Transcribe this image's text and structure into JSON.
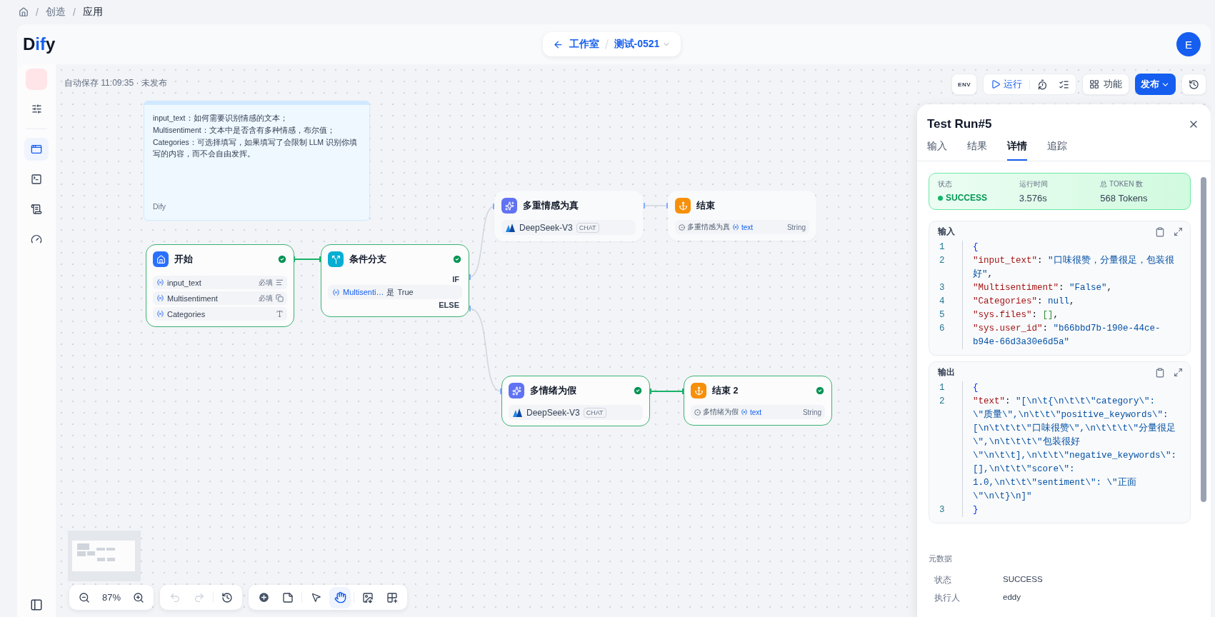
{
  "breadcrumb": {
    "items": [
      {
        "separator": "/",
        "label": "创造"
      },
      {
        "separator": "/",
        "label": "应用"
      }
    ]
  },
  "header": {
    "logo": [
      {
        "text": "D",
        "accent": false
      },
      {
        "text": "if",
        "accent": true
      },
      {
        "text": "y",
        "accent": false
      }
    ],
    "back": "工作室",
    "app": "测试-0521",
    "avatar": "E"
  },
  "sidebar": {
    "items": [
      {
        "kind": "orchestrate",
        "selected": true
      },
      {
        "kind": "api",
        "selected": false
      },
      {
        "kind": "logs",
        "selected": false
      },
      {
        "kind": "monitor",
        "selected": false
      }
    ]
  },
  "canvas": {
    "autosave": "自动保存 11:09:35 · 未发布",
    "toolbar": {
      "env": "ENV",
      "run": "运行",
      "features": "功能",
      "publish": "发布"
    },
    "note": {
      "lines": [
        "input_text：如何需要识别情感的文本；",
        "Multisentiment：文本中是否含有多种情感，布尔值；",
        "Categories：可选择填写，如果填写了会限制 LLM 识别你填写的内容，而不会自由发挥。"
      ],
      "author": "Dify"
    },
    "nodes": [
      {
        "kind": "start",
        "title": "开始",
        "ran": true,
        "variables": [
          {
            "name": "input_text",
            "required": "必填",
            "kind": "text"
          },
          {
            "name": "Multisentiment",
            "required": "必填",
            "kind": "select"
          },
          {
            "name": "Categories",
            "kind": "paragraph"
          }
        ]
      },
      {
        "kind": "if-else",
        "title": "条件分支",
        "ran": true,
        "if_label": "IF",
        "condition": {
          "variable": "Multisenti…",
          "operator": "是",
          "value": "True"
        },
        "else_label": "ELSE"
      },
      {
        "kind": "llm",
        "title": "多重情感为真",
        "ran": false,
        "model": "DeepSeek-V3",
        "mode": "CHAT"
      },
      {
        "kind": "end",
        "title": "结束",
        "ran": false,
        "output": {
          "source": "多重情感为真",
          "variable": "text",
          "type": "String"
        }
      },
      {
        "kind": "llm",
        "title": "多情绪为假",
        "ran": true,
        "model": "DeepSeek-V3",
        "mode": "CHAT"
      },
      {
        "kind": "end",
        "title": "结束 2",
        "ran": true,
        "output": {
          "source": "多情绪为假",
          "variable": "text",
          "type": "String"
        }
      }
    ],
    "edges": [
      {
        "ran": true
      },
      {
        "ran": false
      },
      {
        "ran": false
      },
      {
        "ran": false
      },
      {
        "ran": true
      }
    ],
    "zoom": "87%",
    "modes": [
      {
        "kind": "pointer",
        "selected": false
      },
      {
        "kind": "hand",
        "selected": true
      }
    ]
  },
  "run_panel": {
    "title": "Test Run#5",
    "tabs": [
      {
        "label": "输入",
        "selected": false
      },
      {
        "label": "结果",
        "selected": false
      },
      {
        "label": "详情",
        "selected": true
      },
      {
        "label": "追踪",
        "selected": false
      }
    ],
    "summary": [
      {
        "kind": "status",
        "label": "状态",
        "value": "SUCCESS"
      },
      {
        "kind": "plain",
        "label": "运行时间",
        "value": "3.576s"
      },
      {
        "kind": "plain",
        "label": "总 TOKEN 数",
        "value": "568 Tokens"
      }
    ],
    "blocks": [
      {
        "title": "输入",
        "lines": [
          {
            "num": "1",
            "parts": [
              {
                "kind": "bracket",
                "text": "{"
              }
            ]
          },
          {
            "num": "2",
            "parts": [
              {
                "kind": "key",
                "text": "\"input_text\""
              },
              {
                "kind": "punct",
                "text": ": "
              },
              {
                "kind": "string",
                "text": "\"口味很赞，分量很足，包装很好\""
              },
              {
                "kind": "punct",
                "text": ","
              }
            ]
          },
          {
            "num": "3",
            "parts": [
              {
                "kind": "key",
                "text": "\"Multisentiment\""
              },
              {
                "kind": "punct",
                "text": ": "
              },
              {
                "kind": "string",
                "text": "\"False\""
              },
              {
                "kind": "punct",
                "text": ","
              }
            ]
          },
          {
            "num": "4",
            "parts": [
              {
                "kind": "key",
                "text": "\"Categories\""
              },
              {
                "kind": "punct",
                "text": ": "
              },
              {
                "kind": "keyword",
                "text": "null"
              },
              {
                "kind": "punct",
                "text": ","
              }
            ]
          },
          {
            "num": "5",
            "parts": [
              {
                "kind": "key",
                "text": "\"sys.files\""
              },
              {
                "kind": "punct",
                "text": ": "
              },
              {
                "kind": "array",
                "text": "[]"
              },
              {
                "kind": "punct",
                "text": ","
              }
            ]
          },
          {
            "num": "6",
            "parts": [
              {
                "kind": "key",
                "text": "\"sys.user_id\""
              },
              {
                "kind": "punct",
                "text": ": "
              },
              {
                "kind": "string",
                "text": "\"b66bbd7b-190e-44ce-b94e-66d3a30e6d5a\""
              }
            ]
          }
        ]
      },
      {
        "title": "输出",
        "lines": [
          {
            "num": "1",
            "parts": [
              {
                "kind": "bracket",
                "text": "{"
              }
            ]
          },
          {
            "num": "2",
            "parts": [
              {
                "kind": "key",
                "text": "\"text\""
              },
              {
                "kind": "punct",
                "text": ": "
              },
              {
                "kind": "string",
                "text": "\"[\\n\\t{\\n\\t\\t\\\"category\\\": \\\"质量\\\",\\n\\t\\t\\\"positive_keywords\\\": [\\n\\t\\t\\t\\\"口味很赞\\\",\\n\\t\\t\\t\\\"分量很足\\\",\\n\\t\\t\\t\\\"包装很好\\\"\\n\\t\\t],\\n\\t\\t\\\"negative_keywords\\\": [],\\n\\t\\t\\\"score\\\": 1.0,\\n\\t\\t\\\"sentiment\\\": \\\"正面\\\"\\n\\t}\\n]\""
              }
            ]
          },
          {
            "num": "3",
            "parts": [
              {
                "kind": "bracket",
                "text": "}"
              }
            ]
          }
        ]
      }
    ],
    "metadata": {
      "title": "元数据",
      "rows": [
        {
          "label": "状态",
          "value": "SUCCESS"
        },
        {
          "label": "执行人",
          "value": "eddy"
        }
      ]
    }
  }
}
